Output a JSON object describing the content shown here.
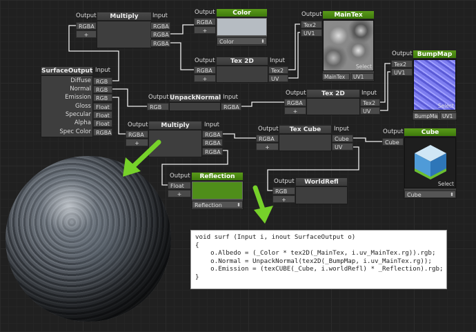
{
  "colors": {
    "wire": "#ffffff",
    "accent": "#4f8e1a",
    "arrow": "#76d12a"
  },
  "common": {
    "output": "Output",
    "input": "Input",
    "plus": "+",
    "rgba": "RGBA",
    "select": "Select"
  },
  "nodes": {
    "multiply_top": {
      "title": "Multiply",
      "in": [
        "RGBA",
        "RGBA",
        "RGBA"
      ],
      "out": "RGBA"
    },
    "color": {
      "title": "Color",
      "dropdown": "Color"
    },
    "maintex": {
      "title": "MainTex",
      "ports": [
        "Tex2",
        "UV1"
      ],
      "mini": [
        "MainTex",
        "UV1"
      ]
    },
    "tex2d_a": {
      "title": "Tex 2D",
      "ins": [
        "Tex2",
        "UV"
      ]
    },
    "bumpmap": {
      "title": "BumpMap",
      "ports": [
        "Tex2",
        "UV1"
      ],
      "mini": [
        "BumpMap",
        "UV1"
      ]
    },
    "surface": {
      "title": "SurfaceOutput",
      "rows": [
        {
          "label": "Diffuse",
          "type": "RGB"
        },
        {
          "label": "Normal",
          "type": "RGB"
        },
        {
          "label": "Emission",
          "type": "RGB"
        },
        {
          "label": "Gloss",
          "type": "Float"
        },
        {
          "label": "Specular",
          "type": "Float"
        },
        {
          "label": "Alpha",
          "type": "Float"
        },
        {
          "label": "Spec Color",
          "type": "RGBA"
        }
      ]
    },
    "unpack": {
      "title": "UnpackNormal",
      "out": "RGB",
      "in": "RGBA"
    },
    "tex2d_b": {
      "title": "Tex 2D",
      "ins": [
        "Tex2",
        "UV"
      ]
    },
    "multiply_mid": {
      "title": "Multiply",
      "in": [
        "RGBA",
        "RGBA",
        "RGBA"
      ]
    },
    "texcube": {
      "title": "Tex Cube",
      "ins": [
        "Cube",
        "UV"
      ]
    },
    "cube": {
      "title": "Cube",
      "port": "Cube",
      "dropdown": "Cube"
    },
    "reflection": {
      "title": "Reflection",
      "out": "Float",
      "dropdown": "Reflection"
    },
    "worldrefl": {
      "title": "WorldRefl",
      "out": "RGB"
    }
  },
  "code": [
    "void surf (Input i, inout SurfaceOutput o)",
    "{",
    "    o.Albedo = (_Color * tex2D(_MainTex, i.uv_MainTex.rg)).rgb;",
    "    o.Normal = UnpackNormal(tex2D(_BumpMap, i.uv_MainTex.rg));",
    "    o.Emission = (texCUBE(_Cube, i.worldRefl) * _Reflection).rgb;",
    "}"
  ]
}
